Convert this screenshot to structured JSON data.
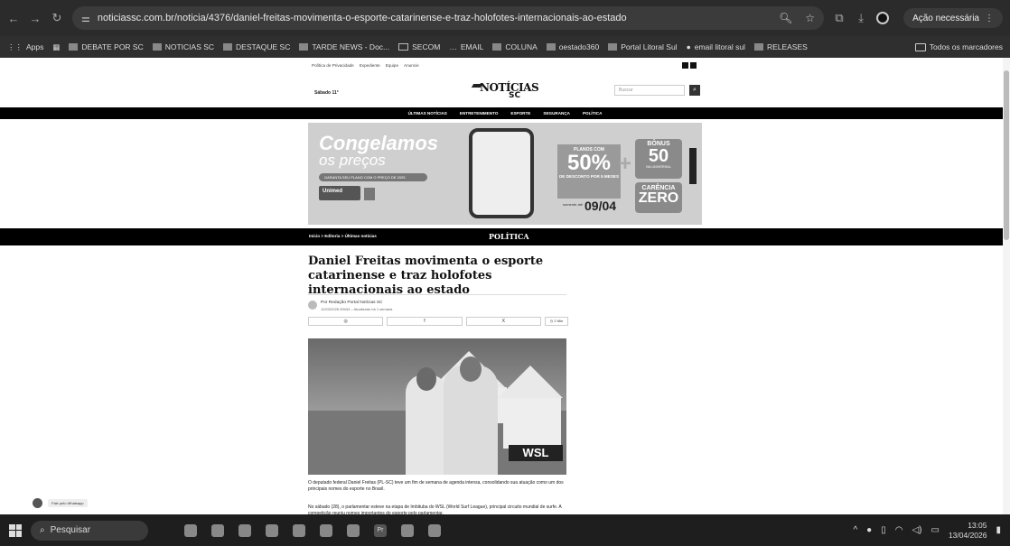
{
  "browser": {
    "url": "noticiassc.com.br/noticia/4376/daniel-freitas-movimenta-o-esporte-catarinense-e-traz-holofotes-internacionais-ao-estado",
    "action_label": "Ação necessária",
    "bookmarks": [
      "Apps",
      "DEBATE POR SC",
      "NOTICIAS SC",
      "DESTAQUE SC",
      "TARDE NEWS - Doc...",
      "SECOM",
      "EMAIL",
      "COLUNA",
      "oestado360",
      "Portal Litoral Sul",
      "email litoral sul",
      "RELEASES"
    ],
    "all_bookmarks": "Todos os marcadores"
  },
  "site": {
    "top_links": [
      "Política de Privacidade",
      "Expediente",
      "Equipe",
      "Anuncie"
    ],
    "date": "Sábado 11°",
    "logo_top": "NOTÍCIAS",
    "logo_bottom": "SC",
    "search_placeholder": "Buscar",
    "nav": [
      "ÚLTIMAS NOTÍCIAS",
      "ENTRETENIMENTO",
      "ESPORTE",
      "SEGURANÇA",
      "POLÍTICA"
    ]
  },
  "ad": {
    "headline1": "Congelamos",
    "headline2": "os preços",
    "cta": "GARANTA SEU PLANO COM O PREÇO DE 2025",
    "brand": "Unimed",
    "plans_label": "PLANOS COM",
    "discount": "50%",
    "discount_sub": "DE DESCONTO POR 5 MESES",
    "bonus_label": "BÔNUS",
    "bonus_value": "50",
    "bonus_sub": "NA UNIVERSAL",
    "carencia1": "CARÊNCIA",
    "carencia2": "ZERO",
    "until": "somente até",
    "until_date": "09/04"
  },
  "article": {
    "breadcrumb": "Início > Editoria > Últimas notícias",
    "category": "POLÍTICA",
    "title": "Daniel Freitas movimenta o esporte catarinense e traz holofotes internacionais ao estado",
    "author": "Por Redação Portal Notícias SC",
    "published": "12/03/2026 09h34 – Atualizado há 1 semana",
    "share_min": "2 Min",
    "photo_brand": "WSL",
    "p1": "O deputado federal Daniel Freitas (PL-SC) teve um fim de semana de agenda intensa, consolidando sua atuação como um dos principais nomes do esporte no Brasil.",
    "p2": "No sábado (28), o parlamentar esteve na etapa de Imbituba do WSL (World Surf League), principal circuito mundial de surfe. A competição reuniu nomes importantes do esporte pelo parlamentar."
  },
  "whatsapp_label": "Fale pelo Whatsapp",
  "taskbar": {
    "search": "Pesquisar",
    "time": "13:05",
    "date": "13/04/2026"
  }
}
